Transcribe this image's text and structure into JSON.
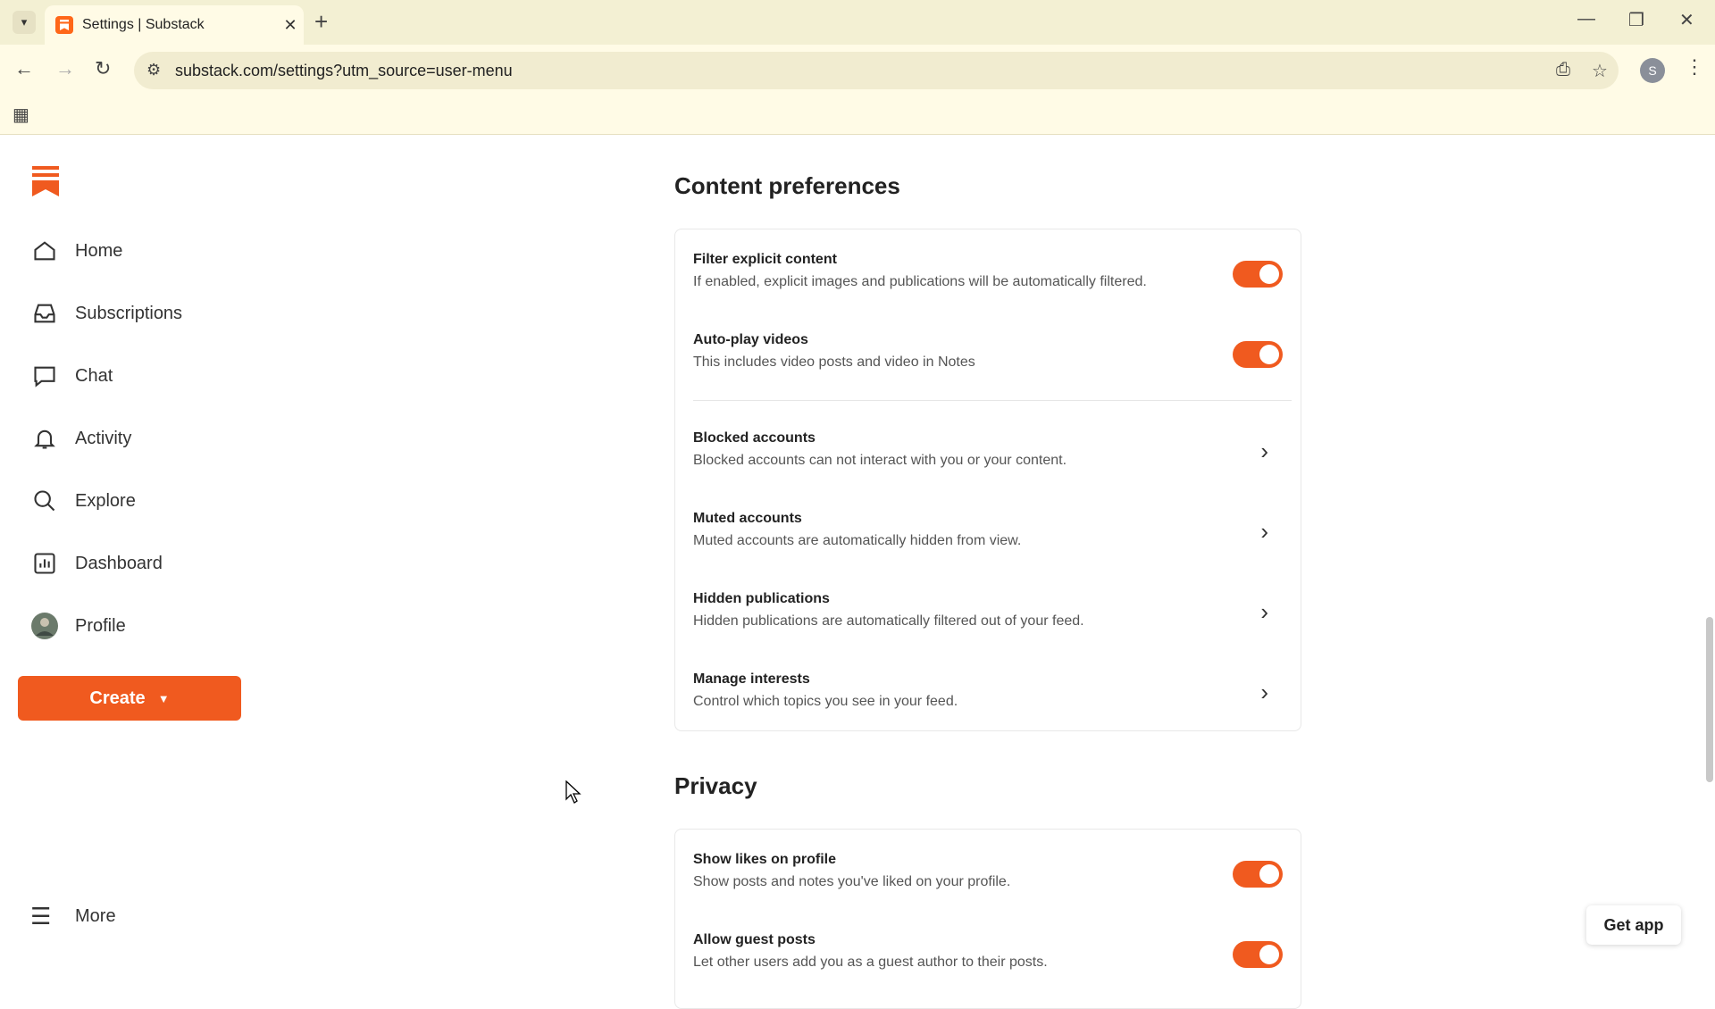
{
  "browser": {
    "tab_title": "Settings | Substack",
    "url": "substack.com/settings?utm_source=user-menu",
    "profile_initial": "S"
  },
  "sidebar": {
    "items": [
      {
        "label": "Home",
        "icon": "home-icon"
      },
      {
        "label": "Subscriptions",
        "icon": "inbox-icon"
      },
      {
        "label": "Chat",
        "icon": "chat-icon"
      },
      {
        "label": "Activity",
        "icon": "bell-icon"
      },
      {
        "label": "Explore",
        "icon": "search-icon"
      },
      {
        "label": "Dashboard",
        "icon": "bar-chart-icon"
      },
      {
        "label": "Profile",
        "icon": "avatar"
      }
    ],
    "create_label": "Create",
    "more_label": "More"
  },
  "content_preferences": {
    "heading": "Content preferences",
    "toggles": [
      {
        "title": "Filter explicit content",
        "subtitle": "If enabled, explicit images and publications will be automatically filtered.",
        "on": true
      },
      {
        "title": "Auto-play videos",
        "subtitle": "This includes video posts and video in Notes",
        "on": true
      }
    ],
    "links": [
      {
        "title": "Blocked accounts",
        "subtitle": "Blocked accounts can not interact with you or your content."
      },
      {
        "title": "Muted accounts",
        "subtitle": "Muted accounts are automatically hidden from view."
      },
      {
        "title": "Hidden publications",
        "subtitle": "Hidden publications are automatically filtered out of your feed."
      },
      {
        "title": "Manage interests",
        "subtitle": "Control which topics you see in your feed."
      }
    ]
  },
  "privacy": {
    "heading": "Privacy",
    "toggles": [
      {
        "title": "Show likes on profile",
        "subtitle": "Show posts and notes you've liked on your profile.",
        "on": true
      },
      {
        "title": "Allow guest posts",
        "subtitle": "Let other users add you as a guest author to their posts.",
        "on": true
      }
    ]
  },
  "get_app_label": "Get app",
  "colors": {
    "accent": "#f05a1f",
    "chrome": "#fffbe6"
  }
}
